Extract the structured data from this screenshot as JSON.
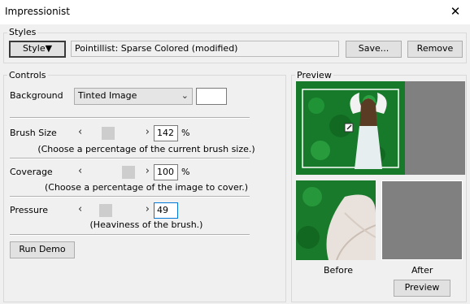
{
  "window": {
    "title": "Impressionist",
    "close_glyph": "✕"
  },
  "styles": {
    "legend": "Styles",
    "style_button": "Style▼",
    "current_style": "Pointillist: Sparse Colored (modified)",
    "save_button": "Save...",
    "remove_button": "Remove"
  },
  "controls": {
    "legend": "Controls",
    "background_label": "Background",
    "background_value": "Tinted Image",
    "background_color": "#ffffff",
    "brush_size": {
      "label": "Brush Size",
      "value": "142",
      "unit": "%",
      "hint": "(Choose a percentage of the current brush size.)",
      "level": 0.35
    },
    "coverage": {
      "label": "Coverage",
      "value": "100",
      "unit": "%",
      "hint": "(Choose a percentage of the image to cover.)",
      "level": 0.87
    },
    "pressure": {
      "label": "Pressure",
      "value": "49",
      "unit": "",
      "hint": "(Heaviness of the brush.)",
      "level": 0.3
    },
    "run_demo_button": "Run Demo"
  },
  "preview": {
    "legend": "Preview",
    "before_label": "Before",
    "after_label": "After",
    "preview_button": "Preview"
  },
  "icons": {
    "slider_left": "‹",
    "slider_right": "›",
    "dropdown": "⌄"
  }
}
